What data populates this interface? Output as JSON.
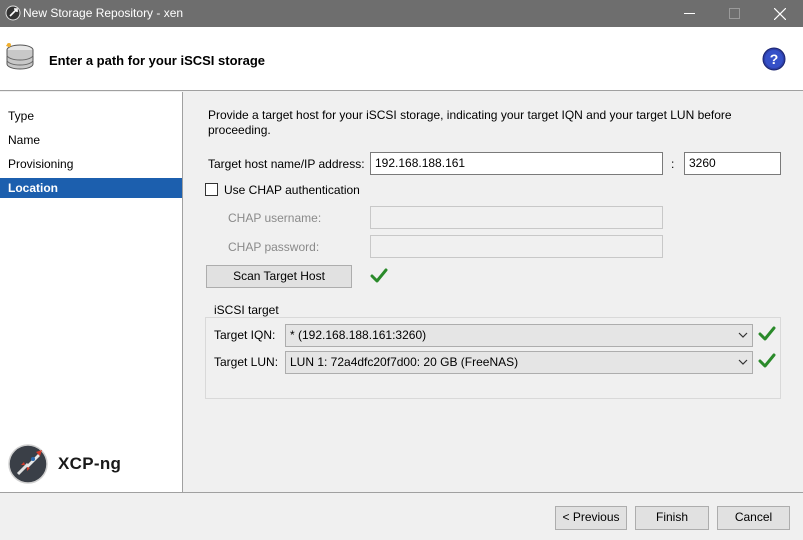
{
  "window": {
    "title": "New Storage Repository - xen"
  },
  "header": {
    "title": "Enter a path for your iSCSI storage"
  },
  "sidebar": {
    "steps": [
      {
        "label": "Type",
        "active": false
      },
      {
        "label": "Name",
        "active": false
      },
      {
        "label": "Provisioning",
        "active": false
      },
      {
        "label": "Location",
        "active": true
      }
    ],
    "logo_text": "XCP-ng"
  },
  "main": {
    "intro": "Provide a target host for your iSCSI storage, indicating your target IQN and your target LUN before proceeding.",
    "host_label": "Target host name/IP address:",
    "host_value": "192.168.188.161",
    "port_separator": ":",
    "port_value": "3260",
    "chap_label": "Use CHAP authentication",
    "chap_checked": false,
    "chap_username_label": "CHAP username:",
    "chap_username_value": "",
    "chap_password_label": "CHAP password:",
    "chap_password_value": "",
    "scan_button": "Scan Target Host",
    "target_group_title": "iSCSI target",
    "iqn_label": "Target IQN:",
    "iqn_value": "* (192.168.188.161:3260)",
    "lun_label": "Target LUN:",
    "lun_value": "LUN 1: 72a4dfc20f7d00: 20 GB (FreeNAS)"
  },
  "footer": {
    "previous": "< Previous",
    "finish": "Finish",
    "cancel": "Cancel"
  },
  "colors": {
    "accent": "#1c5fae",
    "success": "#2a8a2a",
    "titlebar": "#6e6e6e"
  },
  "icons": {
    "app": "xcp-app-icon",
    "storage": "storage-disk-icon",
    "help": "help-icon",
    "check": "green-check-icon",
    "chevron": "chevron-down-icon"
  }
}
